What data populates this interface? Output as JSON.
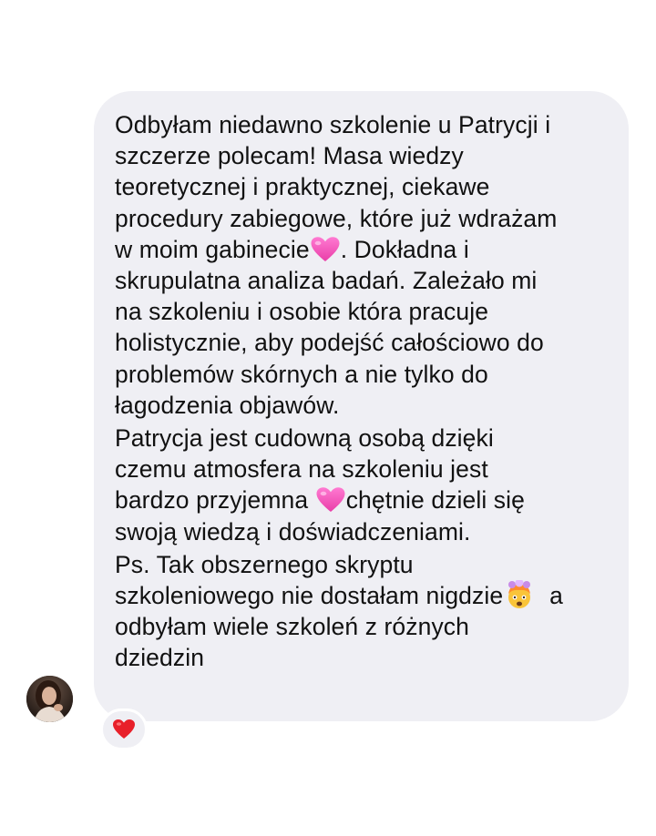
{
  "message": {
    "paragraphs": [
      {
        "lines": [
          {
            "text": "Odbyłam niedawno szkolenie u Patrycji i"
          },
          {
            "text": "szczerze polecam! Masa wiedzy"
          },
          {
            "text": "teoretycznej i praktycznej, ciekawe"
          },
          {
            "text": "procedury zabiegowe, które już wdrażam"
          },
          {
            "text": "w moim gabinecie",
            "emoji": "pink-heart",
            "after": ". Dokładna i"
          },
          {
            "text": "skrupulatna analiza badań. Zależało mi"
          },
          {
            "text": "na szkoleniu i osobie która pracuje"
          },
          {
            "text": "holistycznie, aby podejść całościowo do"
          },
          {
            "text": "problemów skórnych a nie tylko do"
          },
          {
            "text": "łagodzenia objawów."
          }
        ]
      },
      {
        "lines": [
          {
            "text": "Patrycja jest cudowną osobą dzięki"
          },
          {
            "text": "czemu atmosfera na szkoleniu jest"
          },
          {
            "text": "bardzo przyjemna ",
            "emoji": "pink-heart",
            "after": "chętnie dzieli się"
          },
          {
            "text": "swoją wiedzą i doświadczeniami."
          }
        ]
      },
      {
        "lines": [
          {
            "text": "Ps. Tak obszernego skryptu"
          },
          {
            "text": "szkoleniowego nie dostałam nigdzie",
            "emoji": "exploding-head",
            "after": "  a"
          },
          {
            "text": "odbyłam wiele szkoleń z różnych"
          },
          {
            "text": "dziedzin"
          }
        ]
      }
    ]
  },
  "reaction": {
    "icon": "red-heart"
  },
  "sender": {
    "avatar": "profile-photo"
  },
  "colors": {
    "bubble": "#efeff4",
    "text": "#111111",
    "pink_heart": "#f04fb5",
    "red_heart": "#e8202a"
  }
}
